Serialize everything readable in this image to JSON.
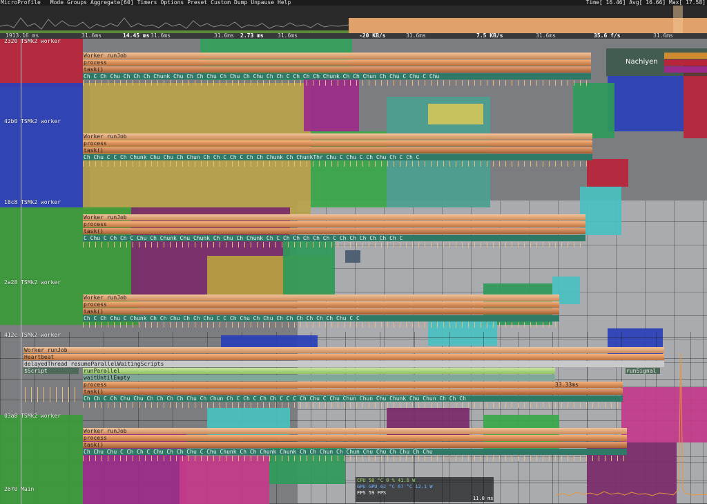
{
  "menu": {
    "app": "MicroProfile",
    "items": [
      "Mode",
      "Groups",
      "Aggregate[60]",
      "Timers",
      "Options",
      "Preset",
      "Custom",
      "Dump",
      "Unpause",
      "Help"
    ],
    "stats": "Time[ 16.46] Avg[ 16.66] Max[ 17.58]"
  },
  "timescale": {
    "start": "1913.16 ms",
    "labels": [
      "31.6ms",
      "14.45 ms",
      "31.6ms",
      "2.73 ms",
      "31.6ms",
      "31.6ms",
      "-20 KB/s",
      "31.6ms",
      "7.5 KB/s",
      "31.6ms",
      "35.6 f/s",
      "31.6ms"
    ]
  },
  "watermark": "Nachiyen",
  "colors": {
    "worker": "#f3c39a",
    "process": "#f7b27b",
    "chunks": "#2f7a66",
    "graph": "#e0a16a"
  },
  "threads": [
    {
      "id": "2320",
      "name": "TSMk2 worker",
      "worker": "Worker runJob",
      "process": "process",
      "task": "task()",
      "chunks": "Ch  C  Ch  Chu  Ch  Ch  Ch  Chunk  Chu  Ch  Ch  Chu      Ch  Chu  Ch  Chu  Ch      Ch  C  Ch  Ch  Ch  Chunk  Ch  Ch  Chun  Ch        Chu  C  Chu  C  Chu"
    },
    {
      "id": "42b0",
      "name": "TSMk2 worker",
      "worker": "Worker runJob",
      "process": "process",
      "task": "task()",
      "chunks": "Ch  Chu  C    C  Ch  Chunk  Chu  Chu  Ch  Chun  Ch  Ch  C  Ch  C  Ch  Ch  Chunk  Ch  ChunkThr    Chu        C  Chu  C  Ch  Chu  Ch  C             Ch        C"
    },
    {
      "id": "18c8",
      "name": "TSMk2 worker",
      "worker": "Worker runJob",
      "process": "process",
      "task": "task()",
      "chunks": "C  Chu  C  Ch  Ch  C  Chu  Ch  Chunk  Chu  Chunk  Ch          Chu       Ch  Chunk  Ch  C    Ch    Ch  Ch    Ch       Ch    C  Ch  Ch  Ch  Ch  Ch  Ch  C"
    },
    {
      "id": "2a28",
      "name": "TSMk2 worker",
      "worker": "Worker runJob",
      "process": "process",
      "task": "task()",
      "chunks": "Ch  C  Ch  Chu    C  Chunk  Ch  Ch     Chu     Ch    Ch  Chu  C     C  Ch     Chu  Ch  Chu     Ch    Ch  Ch  Ch         Ch  Ch  Chu  C         C"
    },
    {
      "id": "412c",
      "name": "TSMk2 worker",
      "worker": "Worker runJob",
      "heartbeat": "Heartbeat",
      "delayed": "delayedThread  resumeParallelWaitingScripts",
      "script": "$Script",
      "runParallel": "runParallel",
      "wait": "waitUntilEmpty",
      "runSignal": "runSignal",
      "process": "process",
      "task": "task()",
      "time": "33.33ms",
      "chunks": "Ch  Ch  C  Ch     Chu      Chu  Ch  Ch  Ch  Ch  Chu  Ch  Chun     Ch  C  Ch  C  Ch  Ch  C  C  C  Ch  Chu  C  Chu       Chun  Chun  Chu  Chunk  Chu  Chun  Ch  Ch       Ch"
    },
    {
      "id": "03a8",
      "name": "TSMk2 worker",
      "worker": "Worker runJob",
      "process": "process",
      "task": "task()",
      "chunks": "Ch    Chu  Chu  C  Ch  Ch  C  Chu  Ch  Ch  Chu  C       Chu  Chunk  Ch  Ch  Chunk  Chunk        Ch  Ch     Chun  Ch  Chun      Chu     Chu       Ch  Chu  Ch  Chu"
    },
    {
      "id": "2670",
      "name": "Main"
    }
  ],
  "hud": {
    "r1": "CPU  58 °C    0 %    41.6 W",
    "r2": "GPU  GPU 62 °C    67 °C    12.1 W",
    "r3": "FPS        59 FPS",
    "time": "11.0 ms"
  }
}
